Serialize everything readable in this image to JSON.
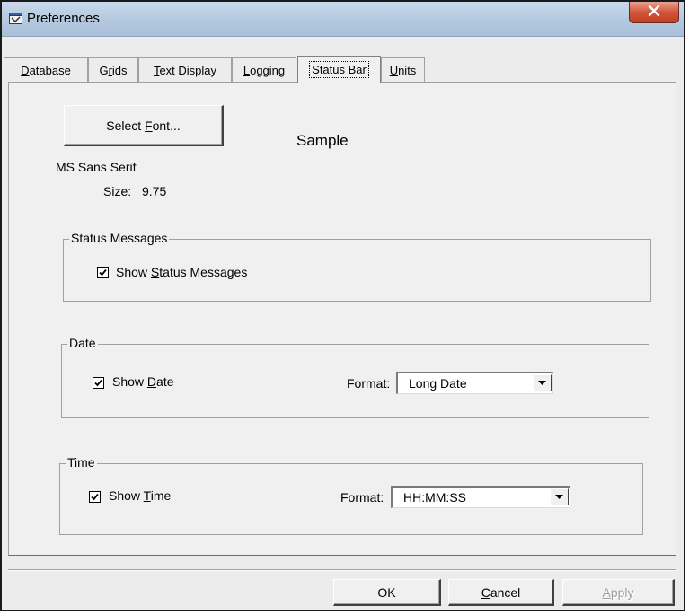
{
  "window": {
    "title": "Preferences"
  },
  "tabs": [
    {
      "pre": "",
      "key": "D",
      "post": "atabase",
      "active": false
    },
    {
      "pre": "G",
      "key": "r",
      "post": "ids",
      "active": false
    },
    {
      "pre": "",
      "key": "T",
      "post": "ext Display",
      "active": false
    },
    {
      "pre": "",
      "key": "L",
      "post": "ogging",
      "active": false
    },
    {
      "pre": "",
      "key": "S",
      "post": "tatus Bar",
      "active": true
    },
    {
      "pre": "",
      "key": "U",
      "post": "nits",
      "active": false
    }
  ],
  "font_section": {
    "select_font_pre": "Select ",
    "select_font_key": "F",
    "select_font_post": "ont...",
    "sample_text": "Sample",
    "font_name": "MS Sans Serif",
    "size_label": "Size:",
    "size_value": "9.75"
  },
  "status_messages": {
    "legend": "Status Messages",
    "checkbox_pre": "Show ",
    "checkbox_key": "S",
    "checkbox_post": "tatus Messages",
    "checked": true
  },
  "date": {
    "legend": "Date",
    "checkbox_pre": "Show ",
    "checkbox_key": "D",
    "checkbox_post": "ate",
    "checked": true,
    "format_label": "Format:",
    "format_value": "Long Date"
  },
  "time": {
    "legend": "Time",
    "checkbox_pre": "Show ",
    "checkbox_key": "T",
    "checkbox_post": "ime",
    "checked": true,
    "format_label": "Format:",
    "format_value": "HH:MM:SS"
  },
  "buttons": {
    "ok": "OK",
    "cancel_key": "C",
    "cancel_post": "ancel",
    "apply_key": "A",
    "apply_post": "pply"
  },
  "icons": {
    "app": "preferences-app-icon",
    "close": "close-icon",
    "check": "checkmark-icon",
    "dropdown": "dropdown-arrow-icon"
  }
}
